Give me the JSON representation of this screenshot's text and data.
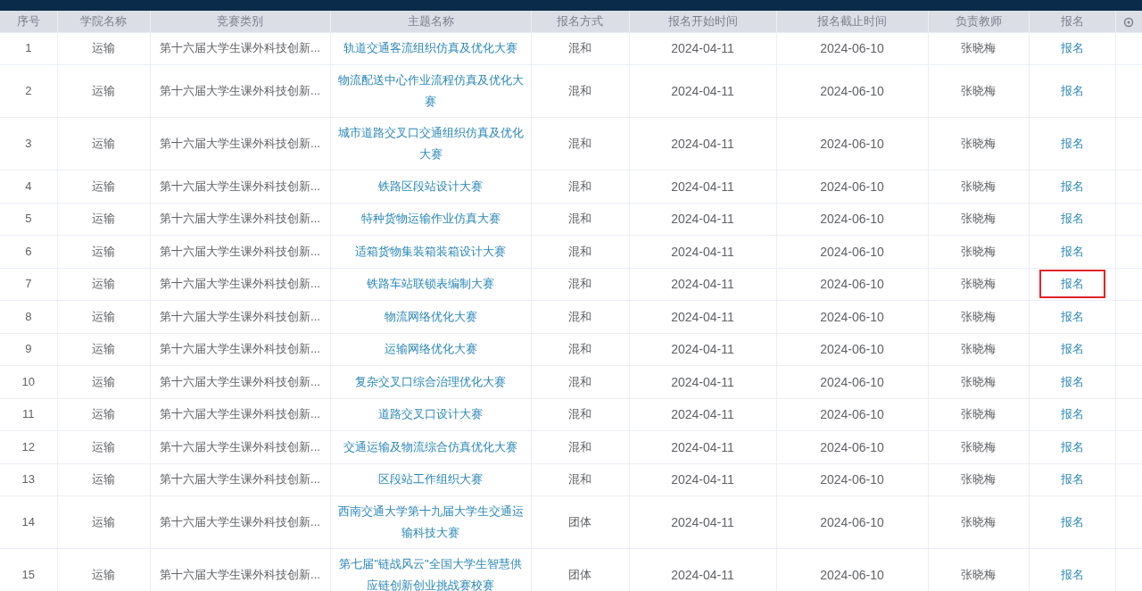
{
  "table": {
    "columns": [
      "序号",
      "学院名称",
      "竞赛类别",
      "主题名称",
      "报名方式",
      "报名开始时间",
      "报名截止时间",
      "负责教师",
      "报名"
    ],
    "rows": [
      {
        "index": "1",
        "college": "运输",
        "category": "第十六届大学生课外科技创新...",
        "topic": "轨道交通客流组织仿真及优化大赛",
        "mode": "混和",
        "start": "2024-04-11",
        "end": "2024-06-10",
        "teacher": "张晓梅",
        "action": "报名",
        "highlighted": false
      },
      {
        "index": "2",
        "college": "运输",
        "category": "第十六届大学生课外科技创新...",
        "topic": "物流配送中心作业流程仿真及优化大赛",
        "mode": "混和",
        "start": "2024-04-11",
        "end": "2024-06-10",
        "teacher": "张晓梅",
        "action": "报名",
        "highlighted": false
      },
      {
        "index": "3",
        "college": "运输",
        "category": "第十六届大学生课外科技创新...",
        "topic": "城市道路交叉口交通组织仿真及优化大赛",
        "mode": "混和",
        "start": "2024-04-11",
        "end": "2024-06-10",
        "teacher": "张晓梅",
        "action": "报名",
        "highlighted": false
      },
      {
        "index": "4",
        "college": "运输",
        "category": "第十六届大学生课外科技创新...",
        "topic": "铁路区段站设计大赛",
        "mode": "混和",
        "start": "2024-04-11",
        "end": "2024-06-10",
        "teacher": "张晓梅",
        "action": "报名",
        "highlighted": false
      },
      {
        "index": "5",
        "college": "运输",
        "category": "第十六届大学生课外科技创新...",
        "topic": "特种货物运输作业仿真大赛",
        "mode": "混和",
        "start": "2024-04-11",
        "end": "2024-06-10",
        "teacher": "张晓梅",
        "action": "报名",
        "highlighted": false
      },
      {
        "index": "6",
        "college": "运输",
        "category": "第十六届大学生课外科技创新...",
        "topic": "适箱货物集装箱装箱设计大赛",
        "mode": "混和",
        "start": "2024-04-11",
        "end": "2024-06-10",
        "teacher": "张晓梅",
        "action": "报名",
        "highlighted": false
      },
      {
        "index": "7",
        "college": "运输",
        "category": "第十六届大学生课外科技创新...",
        "topic": "铁路车站联锁表编制大赛",
        "mode": "混和",
        "start": "2024-04-11",
        "end": "2024-06-10",
        "teacher": "张晓梅",
        "action": "报名",
        "highlighted": true
      },
      {
        "index": "8",
        "college": "运输",
        "category": "第十六届大学生课外科技创新...",
        "topic": "物流网络优化大赛",
        "mode": "混和",
        "start": "2024-04-11",
        "end": "2024-06-10",
        "teacher": "张晓梅",
        "action": "报名",
        "highlighted": false
      },
      {
        "index": "9",
        "college": "运输",
        "category": "第十六届大学生课外科技创新...",
        "topic": "运输网络优化大赛",
        "mode": "混和",
        "start": "2024-04-11",
        "end": "2024-06-10",
        "teacher": "张晓梅",
        "action": "报名",
        "highlighted": false
      },
      {
        "index": "10",
        "college": "运输",
        "category": "第十六届大学生课外科技创新...",
        "topic": "复杂交叉口综合治理优化大赛",
        "mode": "混和",
        "start": "2024-04-11",
        "end": "2024-06-10",
        "teacher": "张晓梅",
        "action": "报名",
        "highlighted": false
      },
      {
        "index": "11",
        "college": "运输",
        "category": "第十六届大学生课外科技创新...",
        "topic": "道路交叉口设计大赛",
        "mode": "混和",
        "start": "2024-04-11",
        "end": "2024-06-10",
        "teacher": "张晓梅",
        "action": "报名",
        "highlighted": false
      },
      {
        "index": "12",
        "college": "运输",
        "category": "第十六届大学生课外科技创新...",
        "topic": "交通运输及物流综合仿真优化大赛",
        "mode": "混和",
        "start": "2024-04-11",
        "end": "2024-06-10",
        "teacher": "张晓梅",
        "action": "报名",
        "highlighted": false
      },
      {
        "index": "13",
        "college": "运输",
        "category": "第十六届大学生课外科技创新...",
        "topic": "区段站工作组织大赛",
        "mode": "混和",
        "start": "2024-04-11",
        "end": "2024-06-10",
        "teacher": "张晓梅",
        "action": "报名",
        "highlighted": false
      },
      {
        "index": "14",
        "college": "运输",
        "category": "第十六届大学生课外科技创新...",
        "topic": "西南交通大学第十九届大学生交通运输科技大赛",
        "mode": "团体",
        "start": "2024-04-11",
        "end": "2024-06-10",
        "teacher": "张晓梅",
        "action": "报名",
        "highlighted": false
      },
      {
        "index": "15",
        "college": "运输",
        "category": "第十六届大学生课外科技创新...",
        "topic": "第七届\"链战风云\"全国大学生智慧供应链创新创业挑战赛校赛",
        "mode": "团体",
        "start": "2024-04-11",
        "end": "2024-06-10",
        "teacher": "张晓梅",
        "action": "报名",
        "highlighted": false
      }
    ]
  }
}
